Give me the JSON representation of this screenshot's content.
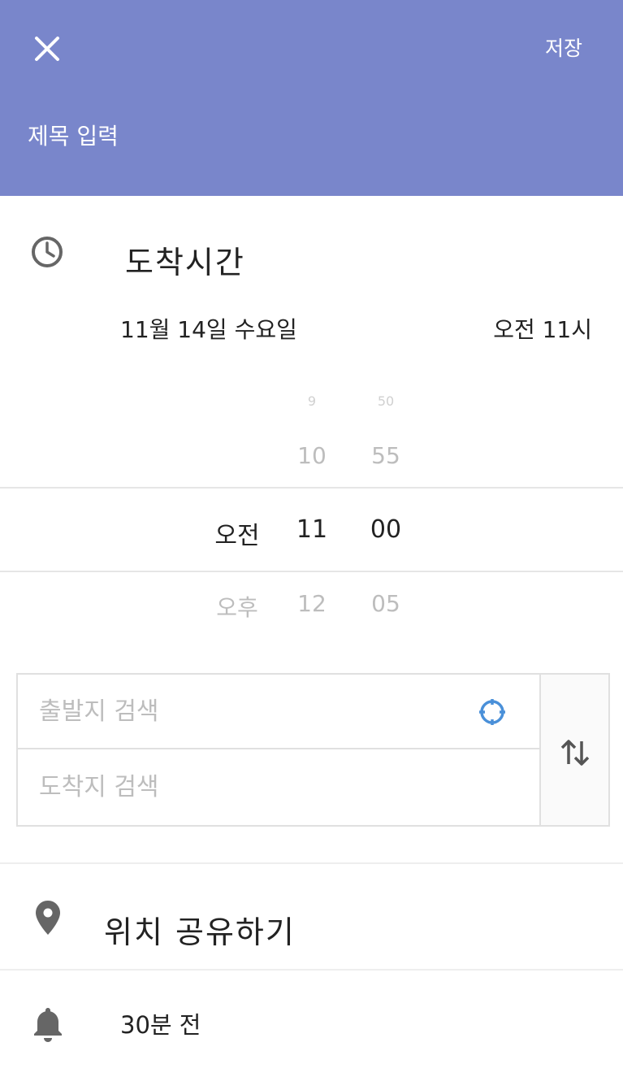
{
  "header": {
    "save_label": "저장",
    "title_placeholder": "제목 입력",
    "background_color": "#7986cb"
  },
  "arrival": {
    "label": "도착시간",
    "icon": "clock-icon"
  },
  "schedule": {
    "date": "11월 14일 수요일",
    "time": "오전 11시"
  },
  "time_picker": {
    "rows": [
      {
        "ampm": "",
        "hour": "9",
        "minute": "50"
      },
      {
        "ampm": "",
        "hour": "10",
        "minute": "55"
      },
      {
        "ampm": "오전",
        "hour": "11",
        "minute": "00"
      },
      {
        "ampm": "오후",
        "hour": "12",
        "minute": "05"
      }
    ],
    "selected_index": 2
  },
  "route": {
    "origin_placeholder": "출발지 검색",
    "destination_placeholder": "도착지 검색",
    "gps_icon": "gps-target-icon",
    "swap_icon": "swap-vertical-icon",
    "accent_color": "#4a90d9"
  },
  "location_share": {
    "label": "위치 공유하기",
    "icon": "map-pin-icon"
  },
  "alarm": {
    "label": "30분 전",
    "icon": "bell-icon"
  }
}
